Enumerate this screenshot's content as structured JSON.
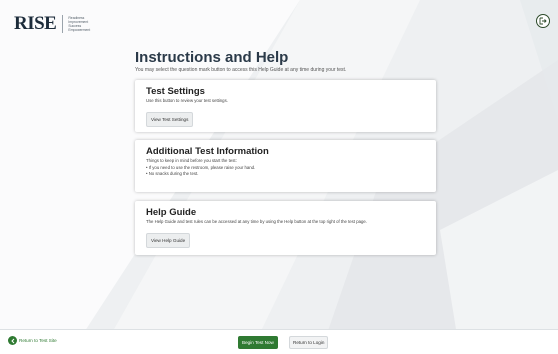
{
  "header": {
    "logo_text": "RISE",
    "logo_sub": [
      "Readiness",
      "Improvement",
      "Success",
      "Empowerment"
    ],
    "exit_icon": "exit-icon"
  },
  "main": {
    "title": "Instructions and Help",
    "subtitle": "You may select the question mark button to access this Help Guide at any time during your test.",
    "cards": {
      "settings": {
        "title": "Test Settings",
        "text": "Use this button to review your test settings.",
        "button": "View Test Settings"
      },
      "additional": {
        "title": "Additional Test Information",
        "text": "Things to keep in mind before you start the test:",
        "bullets": [
          "If you need to use the restroom, please raise your hand.",
          "No snacks during the test."
        ]
      },
      "help": {
        "title": "Help Guide",
        "text": "The Help Guide and test rules can be accessed at any time by using the Help button at the top right of the test page.",
        "button": "View Help Guide"
      }
    }
  },
  "footer": {
    "left_label": "Return to Test Site",
    "left_icon": "arrow-left-icon",
    "begin": "Begin Test Now",
    "return": "Return to Login",
    "ghost": ""
  },
  "colors": {
    "accent": "#2f7a32",
    "title": "#2b3a49",
    "background": "#eef0f2"
  }
}
